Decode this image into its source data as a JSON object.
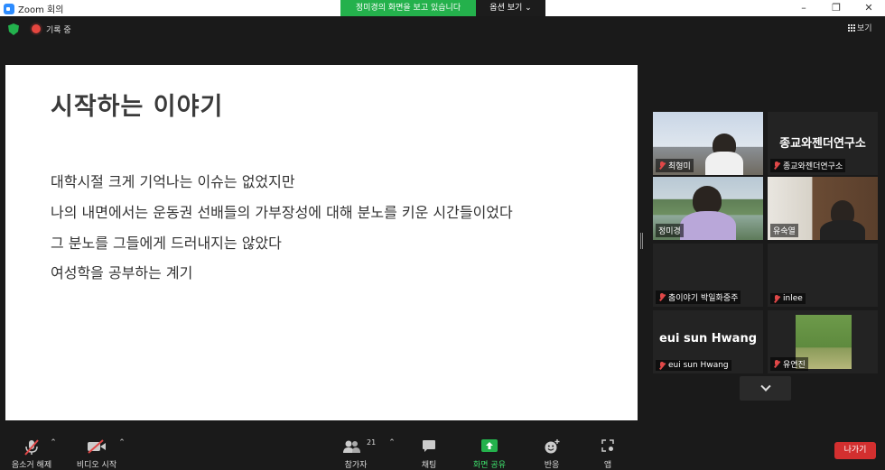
{
  "window": {
    "title": "Zoom 회의",
    "minimize": "–",
    "maximize": "❐",
    "close": "✕"
  },
  "share_banner": {
    "message": "정미경의 화면을 보고 있습니다",
    "options": "옵션 보기 ⌄"
  },
  "top": {
    "recording_label": "기록 중",
    "view_label": "보기"
  },
  "slide": {
    "title": "시작하는 이야기",
    "lines": [
      "대학시절 크게 기억나는 이슈는 없었지만",
      "나의 내면에서는 운동권 선배들의 가부장성에 대해 분노를 키운 시간들이었다",
      "그 분노를 그들에게 드러내지는 않았다",
      "여성학을 공부하는 계기"
    ]
  },
  "gallery": [
    {
      "name": "최형미",
      "display": "",
      "muted": true
    },
    {
      "name": "종교와젠더연구소",
      "display": "종교와젠더연구소",
      "muted": true
    },
    {
      "name": "정미경",
      "display": "",
      "muted": false,
      "active": true
    },
    {
      "name": "유숙열",
      "display": "",
      "muted": false
    },
    {
      "name": "춤이야기 박일화중주",
      "display": "",
      "muted": true
    },
    {
      "name": "inlee",
      "display": "",
      "muted": true
    },
    {
      "name": "eui sun Hwang",
      "display": "eui sun Hwang",
      "muted": true
    },
    {
      "name": "유연진",
      "display": "",
      "muted": true
    }
  ],
  "toolbar": {
    "audio_label": "음소거 해제",
    "video_label": "비디오 시작",
    "participants_label": "참가자",
    "participants_count": "21",
    "chat_label": "채팅",
    "share_label": "화면 공유",
    "reactions_label": "반응",
    "apps_label": "앱",
    "leave_label": "나가기",
    "caret": "⌃"
  },
  "colors": {
    "share_green": "#24b14c",
    "leave_red": "#d32f2f",
    "active_speaker": "#c6e234",
    "muted_red": "#e04848"
  }
}
